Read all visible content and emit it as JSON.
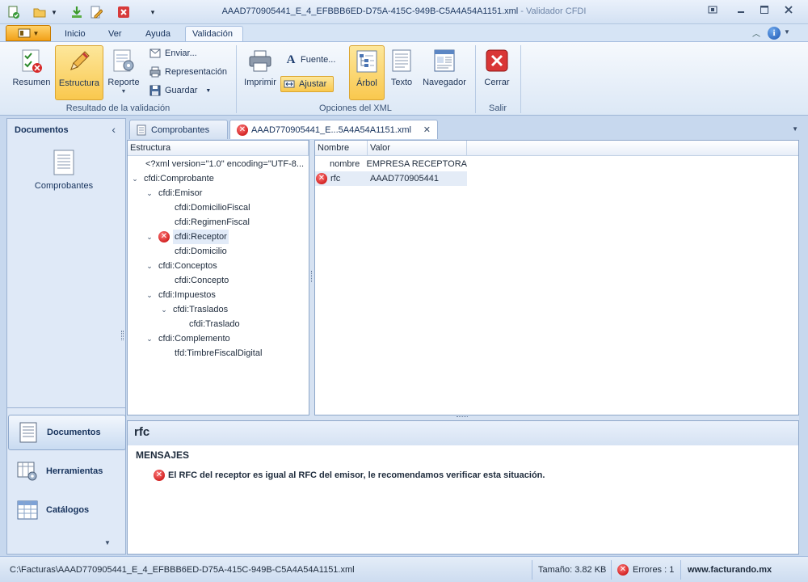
{
  "window": {
    "title": "AAAD770905441_E_4_EFBBB6ED-D75A-415C-949B-C5A4A54A1151.xml",
    "app_name": "Validador CFDI",
    "separator": " - "
  },
  "ribbon_tabs": [
    "Inicio",
    "Ver",
    "Ayuda",
    "Validación"
  ],
  "ribbon": {
    "resultado": {
      "label": "Resultado de la validación",
      "resumen": "Resumen",
      "estructura": "Estructura",
      "reporte": "Reporte",
      "enviar": "Enviar...",
      "representacion": "Representación",
      "guardar": "Guardar"
    },
    "opciones": {
      "label": "Opciones del XML",
      "imprimir": "Imprimir",
      "fuente": "Fuente...",
      "ajustar": "Ajustar",
      "arbol": "Árbol",
      "texto": "Texto",
      "navegador": "Navegador"
    },
    "salir": {
      "label": "Salir",
      "cerrar": "Cerrar"
    }
  },
  "left_panel": {
    "title": "Documentos",
    "item": "Comprobantes",
    "nav": {
      "documentos": "Documentos",
      "herramientas": "Herramientas",
      "catalogos": "Catálogos"
    }
  },
  "doc_tabs": {
    "comprobantes": "Comprobantes",
    "file": "AAAD770905441_E...5A4A54A1151.xml"
  },
  "tree": {
    "header": "Estructura",
    "nodes": [
      "<?xml version=\"1.0\" encoding=\"UTF-8...",
      "cfdi:Comprobante",
      "cfdi:Emisor",
      "cfdi:DomicilioFiscal",
      "cfdi:RegimenFiscal",
      "cfdi:Receptor",
      "cfdi:Domicilio",
      "cfdi:Conceptos",
      "cfdi:Concepto",
      "cfdi:Impuestos",
      "cfdi:Traslados",
      "cfdi:Traslado",
      "cfdi:Complemento",
      "tfd:TimbreFiscalDigital"
    ]
  },
  "grid": {
    "col_name": "Nombre",
    "col_value": "Valor",
    "rows": [
      {
        "name": "nombre",
        "value": "EMPRESA RECEPTORA"
      },
      {
        "name": "rfc",
        "value": "AAAD770905441"
      }
    ]
  },
  "detail": {
    "title": "rfc",
    "section": "MENSAJES",
    "message": "El RFC del receptor es igual al RFC del emisor, le recomendamos verificar esta situación."
  },
  "status": {
    "path": "C:\\Facturas\\AAAD770905441_E_4_EFBBB6ED-D75A-415C-949B-C5A4A54A1151.xml",
    "size": "Tamaño: 3.82 KB",
    "errors": "Errores : 1",
    "site": "www.facturando.mx"
  },
  "colors": {
    "error": "#c00000",
    "selection": "#f9c84e",
    "frame": "#c7d8ee"
  }
}
